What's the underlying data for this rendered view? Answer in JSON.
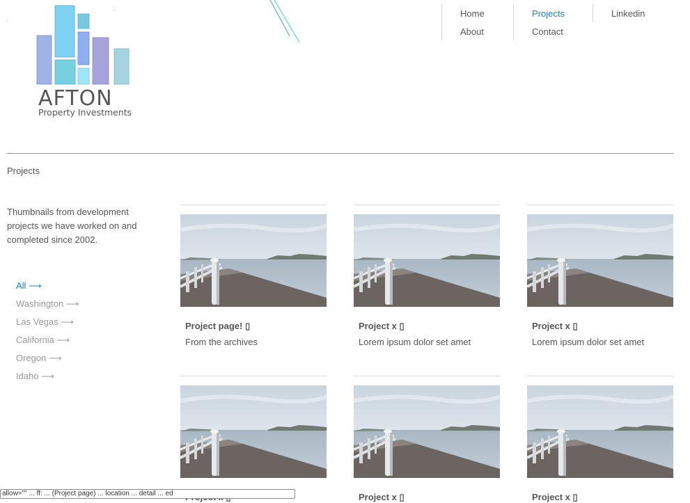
{
  "logo": {
    "name": "AFTON",
    "tagline": "Property Investments",
    "colors": [
      "#9fb3e6",
      "#7fd1f2",
      "#77c9e0",
      "#8faef0",
      "#a7a3dc",
      "#a6d3e0",
      "#8ee0ee",
      "#9fe6f8"
    ]
  },
  "nav": {
    "items": [
      {
        "label": "Home",
        "active": false
      },
      {
        "label": "About",
        "active": false
      },
      {
        "label": "Projects",
        "active": true
      },
      {
        "label": "Contact",
        "active": false
      },
      {
        "label": "Linkedin",
        "active": false
      }
    ],
    "accent_color": "#1b7fc4"
  },
  "page": {
    "title": "Projects",
    "intro": "Thumbnails from development projects we have worked on and completed since 2002."
  },
  "filters": [
    {
      "label": "All ⟶",
      "active": true
    },
    {
      "label": "Washington ⟶",
      "active": false
    },
    {
      "label": "Las Vegas ⟶",
      "active": false
    },
    {
      "label": "California ⟶",
      "active": false
    },
    {
      "label": "Oregon ⟶",
      "active": false
    },
    {
      "label": "Idaho ⟶",
      "active": false
    }
  ],
  "projects": [
    {
      "title": "Project page! ▯",
      "desc": "From the archives",
      "thumb_icon": "pier-photo"
    },
    {
      "title": "Project x ▯",
      "desc": "Lorem ipsum dolor set amet",
      "thumb_icon": "pier-photo"
    },
    {
      "title": "Project x ▯",
      "desc": "Lorem ipsum dolor set amet",
      "thumb_icon": "pier-photo"
    },
    {
      "title": "Project x ▯",
      "desc": "",
      "thumb_icon": "pier-photo"
    },
    {
      "title": "Project x ▯",
      "desc": "",
      "thumb_icon": "pier-photo"
    },
    {
      "title": "Project x ▯",
      "desc": "",
      "thumb_icon": "pier-photo"
    }
  ],
  "status_tooltip": "allow=\"\" ... ff: ... (Project page) ... location ... detail ... ed"
}
